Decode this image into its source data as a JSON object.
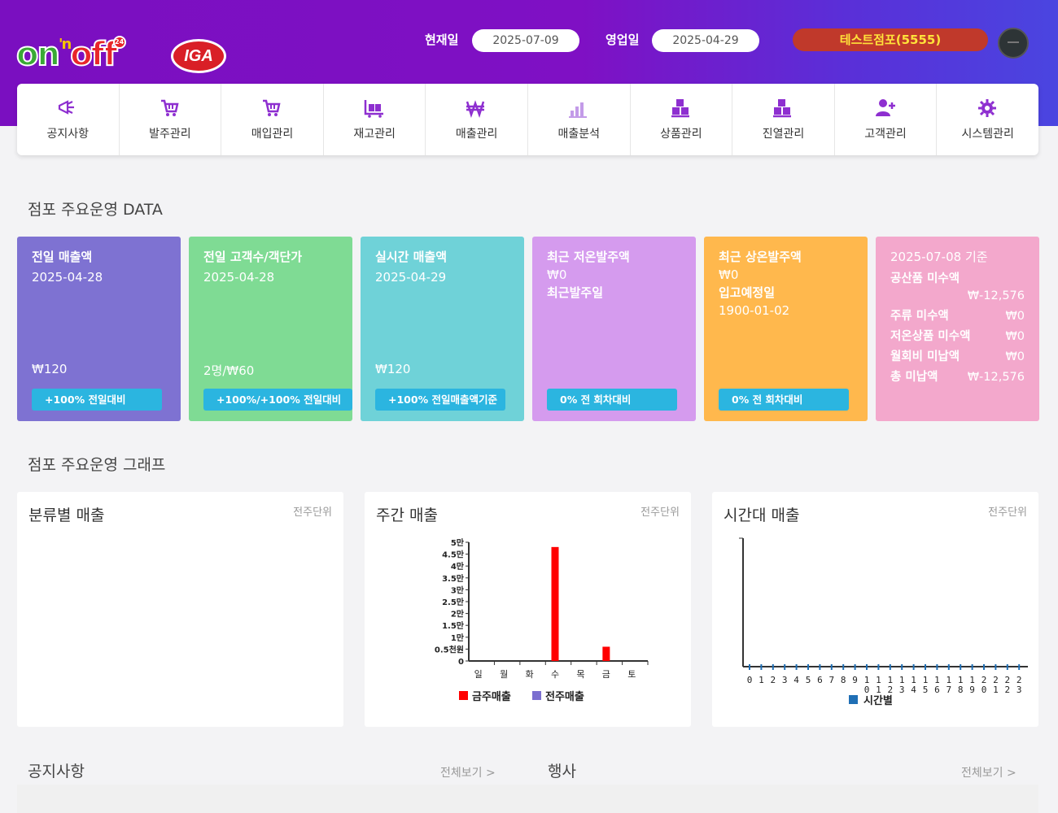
{
  "header": {
    "logo_onoff": {
      "on": "on",
      "n": "'n",
      "off": "off",
      "badge": "24"
    },
    "logo_iga": "IGA",
    "current_date_label": "현재일",
    "current_date": "2025-07-09",
    "business_date_label": "영업일",
    "business_date": "2025-04-29",
    "store_name": "테스트점포(5555)",
    "colors": {
      "gradient_start": "#7a0fc0",
      "gradient_end": "#4a45e0",
      "store_button": "#c0392b",
      "store_text": "#ffe23a"
    }
  },
  "menu": {
    "items": [
      {
        "label": "공지사항",
        "icon": "megaphone-icon"
      },
      {
        "label": "발주관리",
        "icon": "cart-icon"
      },
      {
        "label": "매입관리",
        "icon": "cart-icon"
      },
      {
        "label": "재고관리",
        "icon": "inventory-icon"
      },
      {
        "label": "매출관리",
        "icon": "won-icon"
      },
      {
        "label": "매출분석",
        "icon": "bar-chart-icon"
      },
      {
        "label": "상품관리",
        "icon": "boxes-icon"
      },
      {
        "label": "진열관리",
        "icon": "boxes-icon"
      },
      {
        "label": "고객관리",
        "icon": "user-add-icon"
      },
      {
        "label": "시스템관리",
        "icon": "gear-icon"
      }
    ]
  },
  "data_section": {
    "title": "점포 주요운영 DATA",
    "cards": [
      {
        "title": "전일 매출액",
        "date": "2025-04-28",
        "value": "₩120",
        "badge": "+100% 전일대비",
        "color": "#7e72d2"
      },
      {
        "title": "전일 고객수/객단가",
        "date": "2025-04-28",
        "value": "2명/₩60",
        "badge": "+100%/+100% 전일대비",
        "color": "#7fdb94"
      },
      {
        "title": "실시간 매출액",
        "date": "2025-04-29",
        "value": "₩120",
        "badge": "+100% 전일매출액기준",
        "color": "#6fd2d8"
      },
      {
        "title": "최근 저온발주액",
        "line2": "₩0",
        "line3": "최근발주일",
        "badge": "0% 전 회차대비",
        "color": "#d59bee"
      },
      {
        "title": "최근 상온발주액",
        "line2": "₩0",
        "line3": "입고예정일",
        "line4": "1900-01-02",
        "badge": "0% 전 회차대비",
        "color": "#ffb84d"
      },
      {
        "header": "2025-07-08 기준",
        "color": "#f3a8cc",
        "rows": [
          {
            "label": "공산품 미수액",
            "value": "₩-12,576"
          },
          {
            "label": "주류 미수액",
            "value": "₩0"
          },
          {
            "label": "저온상품 미수액",
            "value": "₩0"
          },
          {
            "label": "월회비 미납액",
            "value": "₩0"
          },
          {
            "label": "총 미납액",
            "value": "₩-12,576"
          }
        ]
      }
    ]
  },
  "graph_section": {
    "title": "점포 주요운영 그래프",
    "panels": [
      {
        "title": "분류별 매출",
        "unit": "전주단위"
      },
      {
        "title": "주간 매출",
        "unit": "전주단위"
      },
      {
        "title": "시간대 매출",
        "unit": "전주단위"
      }
    ]
  },
  "chart_data": [
    {
      "type": "bar",
      "title": "주간 매출",
      "categories": [
        "일",
        "월",
        "화",
        "수",
        "목",
        "금",
        "토"
      ],
      "series": [
        {
          "name": "금주매출",
          "color": "#ff0000",
          "values": [
            0,
            0,
            0,
            48000,
            0,
            6000,
            0
          ]
        },
        {
          "name": "전주매출",
          "color": "#7b6fd0",
          "values": [
            0,
            0,
            0,
            0,
            0,
            0,
            0
          ]
        }
      ],
      "yticks": [
        "0",
        "0.5천원",
        "1만",
        "1.5만",
        "2만",
        "2.5만",
        "3만",
        "3.5만",
        "4만",
        "4.5만",
        "5만"
      ],
      "ylim": [
        0,
        50000
      ]
    },
    {
      "type": "bar",
      "title": "시간대 매출",
      "categories": [
        "0",
        "1",
        "2",
        "3",
        "4",
        "5",
        "6",
        "7",
        "8",
        "9",
        "10",
        "11",
        "12",
        "13",
        "14",
        "15",
        "16",
        "17",
        "18",
        "19",
        "20",
        "21",
        "22",
        "23"
      ],
      "series": [
        {
          "name": "시간별",
          "color": "#1f6fb5",
          "values": [
            0,
            0,
            0,
            0,
            0,
            0,
            0,
            0,
            0,
            0,
            0,
            0,
            0,
            0,
            0,
            0,
            0,
            0,
            0,
            0,
            0,
            0,
            0,
            0
          ]
        }
      ]
    }
  ],
  "bottom": {
    "notice_title": "공지사항",
    "notice_more": "전체보기 >",
    "event_title": "행사",
    "event_more": "전체보기 >"
  }
}
